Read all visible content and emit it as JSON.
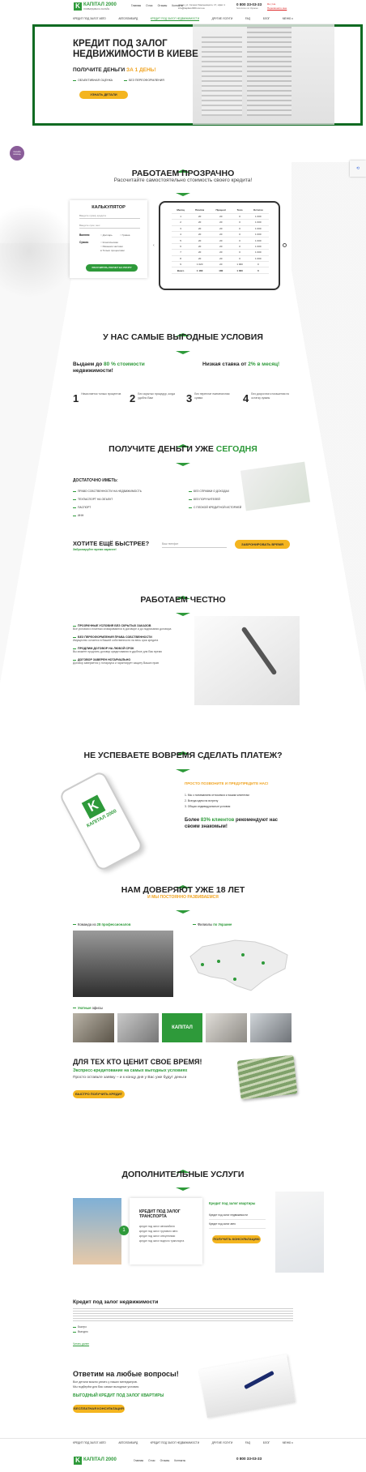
{
  "header": {
    "logo_main": "КАПІТАЛ 2000",
    "logo_sub": "ЛОМБАРД-ВЕСЬ ОНЛАЙН",
    "links": [
      "Главная",
      "О нас",
      "Отзывы",
      "Контакты"
    ],
    "address": "г.Киев, ул. Сечени Хмельницкого, 17, офис 1",
    "email": "info@kapital-2000.com.ua",
    "phone": "0 800 33-03-33",
    "phone_note": "бесплатно по Украине",
    "lang": "Ru | Ua",
    "callback": "Перезвоните мне",
    "nav": [
      "КРЕДИТ ПОД ЗАЛОГ АВТО",
      "АВТОЛОМБАРД",
      "КРЕДИТ ПОД ЗАЛОГ НЕДВИЖИМОСТИ",
      "ДРУГИЕ УСЛУГИ",
      "FAQ",
      "БЛОГ",
      "МЕНЮ"
    ]
  },
  "hero": {
    "title_line1": "КРЕДИТ ПОД ЗАЛОГ",
    "title_line2": "НЕДВИЖИМОСТИ В КИЕВЕ",
    "subtitle_a": "ПОЛУЧИТЕ ДЕНЬГИ ",
    "subtitle_b": "ЗА 1 ДЕНЬ!",
    "bullet1": "ОБЪЕКТИВНАЯ ОЦЕНКА",
    "bullet2": "БЕЗ ПЕРЕОФОРМЛЕНИЯ",
    "button": "УЗНАТЬ ДЕТАЛИ"
  },
  "chat_badge": "Онлайн помощь",
  "transparent": {
    "title": "РАБОТАЕМ ПРОЗРАЧНО",
    "subtitle": "Рассчитайте самостоятельно стоимость своего кредита!",
    "calc_title": "КАЛЬКУЛЯТОР",
    "field1_placeholder": "Введите сумму кредита",
    "field2_placeholder": "Введите срок, мес",
    "currency_label": "Валюта:",
    "currency_opts": [
      "Долларь",
      "Гривна"
    ],
    "sum_label": "Сумма:",
    "sum_opts": [
      "Классическая",
      "Равными частями",
      "Только процентами"
    ],
    "calc_button": "РАССЧИТАТЬ РАСЧЕТ НА ПОЧТУ",
    "table_headers": [
      "Месяц",
      "Платёж",
      "Процент",
      "Тело",
      "Остаток"
    ],
    "table_rows": [
      [
        "1",
        "20",
        "20",
        "0",
        "1 000"
      ],
      [
        "2",
        "20",
        "20",
        "0",
        "1 000"
      ],
      [
        "3",
        "20",
        "20",
        "0",
        "1 000"
      ],
      [
        "4",
        "20",
        "20",
        "0",
        "1 000"
      ],
      [
        "5",
        "20",
        "20",
        "0",
        "1 000"
      ],
      [
        "6",
        "20",
        "20",
        "0",
        "1 000"
      ],
      [
        "7",
        "20",
        "20",
        "0",
        "1 000"
      ],
      [
        "8",
        "20",
        "20",
        "0",
        "1 000"
      ],
      [
        "9",
        "1 020",
        "20",
        "1 000",
        "0"
      ],
      [
        "Всего",
        "1 180",
        "180",
        "1 000",
        "0"
      ]
    ]
  },
  "conditions": {
    "title": "У НАС САМЫЕ ВЫГОДНЫЕ УСЛОВИЯ",
    "left_a": "Выдаем до ",
    "left_b": "80 % стоимости",
    "left_c": "недвижимости!",
    "right_a": "Низкая ставка от ",
    "right_b": "2% в месяц!",
    "steps": [
      {
        "num": "1",
        "text": "Начисляется только процентов"
      },
      {
        "num": "2",
        "text": "Без скрытых процедур, когда удобно Вам"
      },
      {
        "num": "3",
        "text": "Без переплат ежемесячная сумма"
      },
      {
        "num": "4",
        "text": "Без досрочного погашения по остатку суммы"
      }
    ]
  },
  "today": {
    "title_a": "ПОЛУЧИТЕ ДЕНЬГИ УЖЕ ",
    "title_b": "СЕГОДНЯ",
    "enough": "ДОСТАТОЧНО ИМЕТЬ:",
    "left_items": [
      "ПРАВО СОБСТВЕННОСТИ НА НЕДВИЖИМОСТЬ",
      "ТЕХПАСПОРТ НА ОБЪЕКТ",
      "ПАСПОРТ",
      "ИНН"
    ],
    "right_items": [
      "БЕЗ СПРАВКИ О ДОХОДАХ",
      "БЕЗ ПОРУЧИТЕЛЕЙ",
      "С ПЛОХОЙ КРЕДИТНОЙ ИСТОРИЕЙ"
    ],
    "faster": "ХОТИТЕ ЕЩЁ БЫСТРЕЕ?",
    "faster_sub": "Забронируйте время заранее!",
    "phone_placeholder": "Ваш телефон",
    "faster_button": "ЗАБРОНИРОВАТЬ ВРЕМЯ"
  },
  "honest": {
    "title": "РАБОТАЕМ ЧЕСТНО",
    "items": [
      {
        "head": "ПРОЗРАЧНЫЕ УСЛОВИЯ БЕЗ СКРЫТЫХ ЗАКАЗОВ",
        "text": "Все условия и платежи оговариваются в договоре и до подписания договора"
      },
      {
        "head": "БЕЗ ПЕРЕОФОРМЛЕНИЯ ПРАВА СОБСТВЕННОСТИ",
        "text": "Имущество остается в Вашей собственности на весь срок кредита"
      },
      {
        "head": "ПРОДЛИМ ДОГОВОР НА ЛЮБОЙ СРОК",
        "text": "Вы можете продлить договор кредитования в удобное для Вас время"
      },
      {
        "head": "ДОГОВОР ЗАВЕРЕН НОТАРИАЛЬНО",
        "text": "Договор заверяется у нотариуса и гарантирует защиту Ваших прав"
      }
    ]
  },
  "late": {
    "title": "НЕ УСПЕВАЕТЕ ВОВРЕМЯ СДЕЛАТЬ ПЛАТЕЖ?",
    "call": "ПРОСТО ПОЗВОНИТЕ И ПРЕДУПРЕДИТЕ НАС!",
    "points": [
      "1. Мы с пониманием относимся к нашим клиентам",
      "2. Всегда идем на встречу",
      "3. Общая индивидуальные условия"
    ],
    "more_a": "Более ",
    "more_b": "83% клиентов",
    "more_c": " рекомендуют нас своим знакомым!",
    "phone_logo": "КАПІТАЛ 2000"
  },
  "trust": {
    "title": "НАМ ДОВЕРЯЮТ УЖЕ 18 ЛЕТ",
    "subtitle": "И МЫ ПОСТОЯННО РАЗВИВАЕМСЯ",
    "team_a": "Команда из ",
    "team_b": "28 профессионалов",
    "branches_a": "Филиалы ",
    "branches_b": "по Украине",
    "offices_a": "Уютные ",
    "offices_b": "офисы",
    "office_logo": "КАПІТАЛ"
  },
  "value": {
    "title": "ДЛЯ ТЕХ КТО ЦЕНИТ СВОЕ ВРЕМЯ!",
    "sub1": "Экспресс-кредитование на самых выгодных условиях",
    "sub2": "Просто оставьте заявку – и к концу дня у Вас уже будут деньги",
    "button": "БЫСТРО ПОЛУЧИТЬ КРЕДИТ"
  },
  "extra": {
    "title": "ДОПОЛНИТЕЛЬНЫЕ УСЛУГИ",
    "card_title": "КРЕДИТ ПОД ЗАЛОГ ТРАНСПОРТА",
    "card_items": [
      "кредит под залог автомобиля",
      "кредит под залог грузового авто",
      "кредит под залог спецтехники",
      "кредит под залог водного транспорта"
    ],
    "side_title": "Кредит под залог квартиры",
    "side_items": [
      "Кредит под залог недвижимости",
      "Кредит под залог авто"
    ],
    "side_button": "ПОЛУЧИТЬ КОНСУЛЬТАЦИЮ",
    "badge": "1"
  },
  "seo": {
    "title": "Кредит под залог недвижимости",
    "items": [
      "Быстро",
      "Выгодно"
    ],
    "more": "Читать далее"
  },
  "faq": {
    "title": "Ответим на любые вопросы!",
    "text1": "Все детали можно узнать у наших менеджеров.",
    "text2": "Мы подберём для Вас самые выгодные условия.",
    "green": "ВЫГОДНЫЙ КРЕДИТ ПОД ЗАЛОГ КВАРТИРЫ",
    "button": "БЕСПЛАТНАЯ КОНСУЛЬТАЦИЯ"
  },
  "footer": {
    "nav": [
      "КРЕДИТ ПОД ЗАЛОГ АВТО",
      "АВТОЛОМБАРД",
      "КРЕДИТ ПОД ЗАЛОГ НЕДВИЖИМОСТИ",
      "ДРУГИЕ УСЛУГИ",
      "FAQ",
      "БЛОГ",
      "МЕНЮ"
    ],
    "links": [
      "Главная",
      "О нас",
      "Отзывы",
      "Контакты"
    ],
    "phone": "0 800 33-03-33"
  },
  "colors": {
    "brand_green": "#2e9a3a",
    "accent_yellow": "#f4b51f",
    "accent_orange": "#f0a320"
  }
}
